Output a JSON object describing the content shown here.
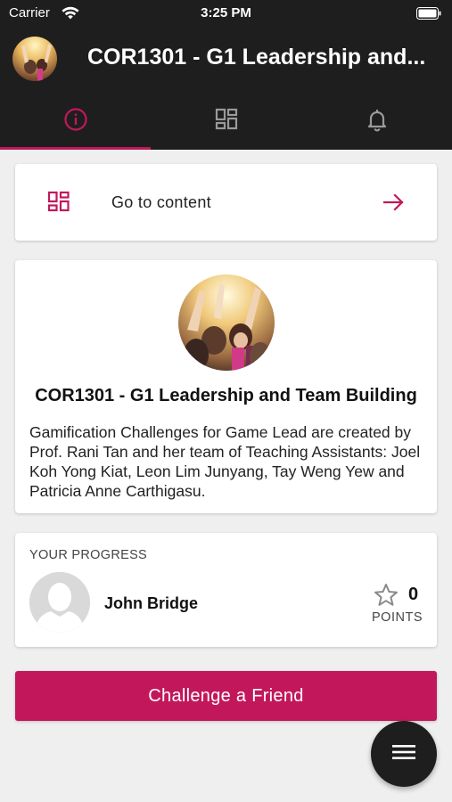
{
  "status_bar": {
    "carrier": "Carrier",
    "time": "3:25 PM"
  },
  "header": {
    "title": "COR1301 - G1 Leadership and..."
  },
  "tabs": [
    {
      "name": "info-icon",
      "selected": true
    },
    {
      "name": "grid-icon",
      "selected": false
    },
    {
      "name": "bell-icon",
      "selected": false
    }
  ],
  "goto_card": {
    "label": "Go to content",
    "icon": "grid-icon",
    "arrow_icon": "arrow-right-icon"
  },
  "course": {
    "title": "COR1301 - G1 Leadership and Team Building",
    "description": "Gamification Challenges for Game Lead are created by Prof. Rani Tan and her team of Teaching Assistants: Joel Koh Yong Kiat, Leon Lim Junyang, Tay Weng Yew and Patricia Anne Carthigasu."
  },
  "progress": {
    "heading": "YOUR PROGRESS",
    "user_name": "John Bridge",
    "points_value": "0",
    "points_label": "POINTS"
  },
  "challenge_button": {
    "label": "Challenge a Friend"
  },
  "fab": {
    "icon": "menu-icon"
  },
  "colors": {
    "accent": "#c2185b",
    "dark": "#1e1e1e",
    "background": "#efefef"
  }
}
